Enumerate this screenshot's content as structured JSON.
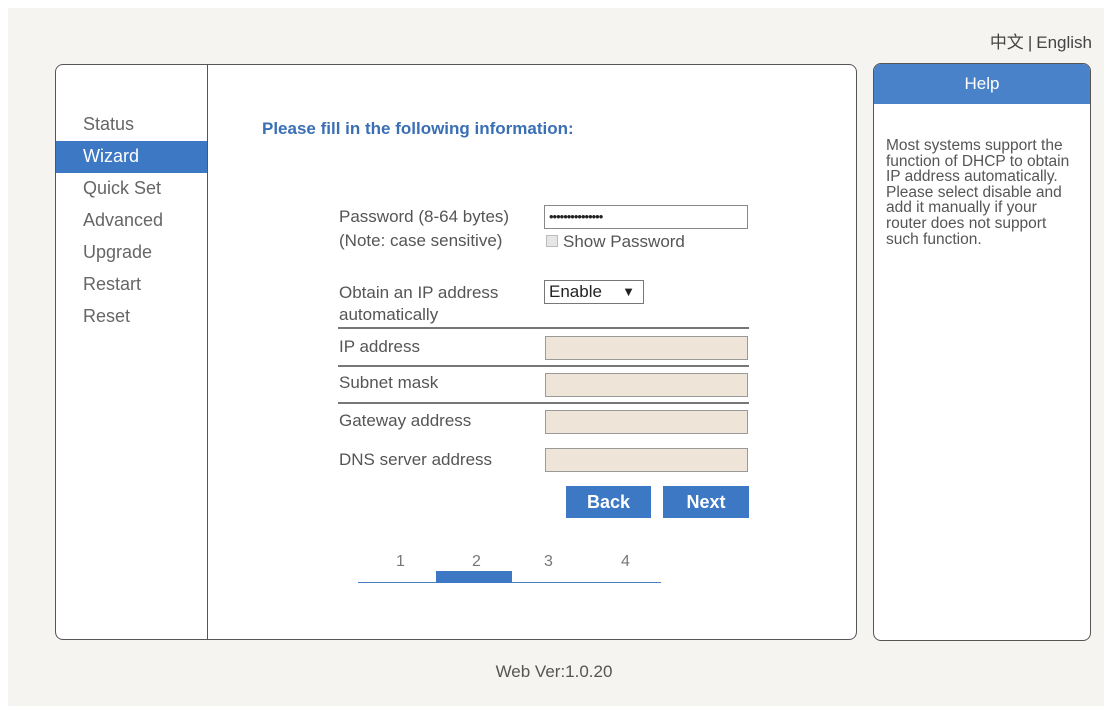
{
  "lang": {
    "chinese": "中文",
    "separator": "|",
    "english": "English"
  },
  "sidebar": {
    "items": [
      {
        "label": "Status"
      },
      {
        "label": "Wizard"
      },
      {
        "label": "Quick Set"
      },
      {
        "label": "Advanced"
      },
      {
        "label": "Upgrade"
      },
      {
        "label": "Restart"
      },
      {
        "label": "Reset"
      }
    ],
    "active": "Wizard"
  },
  "form": {
    "title": "Please fill in the following information:",
    "password_label_1": "Password (8-64 bytes)",
    "password_label_2": "(Note: case sensitive)",
    "password_value": "•••••••••••••••",
    "show_password_label": "Show Password",
    "dhcp_label_1": "Obtain an IP address",
    "dhcp_label_2": "automatically",
    "dhcp_selected": "Enable",
    "ip_label": "IP address",
    "subnet_label": "Subnet mask",
    "gateway_label": "Gateway address",
    "dns_label": "DNS server address",
    "back_label": "Back",
    "next_label": "Next"
  },
  "steps": {
    "items": [
      "1",
      "2",
      "3",
      "4"
    ],
    "current": "2"
  },
  "help": {
    "title": "Help",
    "text": "Most systems support the function of DHCP to obtain IP address automatically. Please select disable and add it manually if your router does not support such function."
  },
  "footer": {
    "version": "Web Ver:1.0.20"
  },
  "colors": {
    "accent": "#3c78c3",
    "disabled_field": "#efe4d8",
    "title": "#3a6fb5"
  }
}
